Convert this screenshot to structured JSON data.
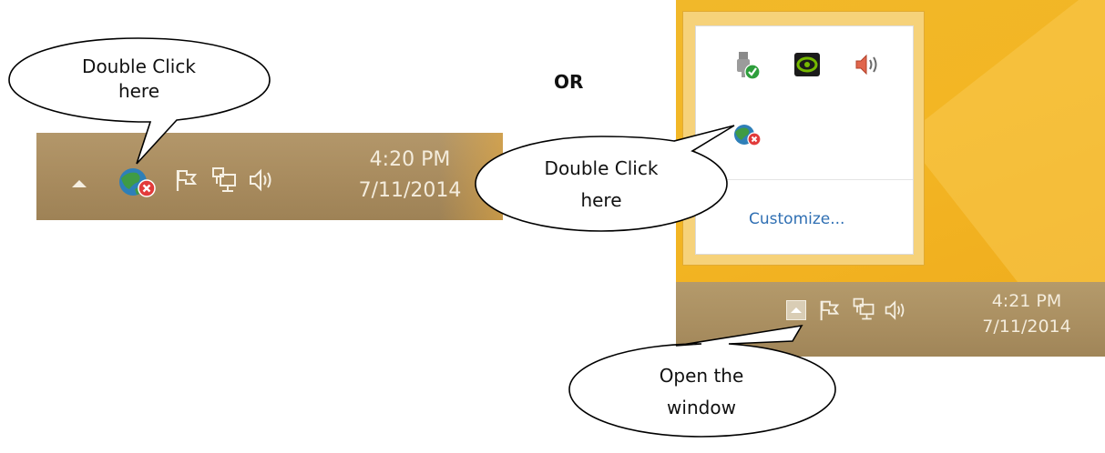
{
  "separator": {
    "label": "OR"
  },
  "callouts": {
    "left_top": {
      "line1": "Double Click",
      "line2": "here"
    },
    "right_middle": {
      "line1": "Double Click",
      "line2": "here"
    },
    "right_bottom": {
      "line1": "Open the",
      "line2": "window"
    }
  },
  "left_taskbar": {
    "clock": {
      "time": "4:20 PM",
      "date": "7/11/2014"
    },
    "icons": [
      "show-hidden-icons-arrow-icon",
      "network-app-error-icon",
      "action-center-flag-icon",
      "network-wired-icon",
      "speaker-volume-icon"
    ]
  },
  "right_screenshot": {
    "tray_popup": {
      "icons": [
        "usb-safely-remove-icon",
        "nvidia-icon",
        "speaker-volume-icon",
        "network-app-error-icon"
      ],
      "customize_label": "Customize..."
    },
    "taskbar": {
      "clock": {
        "time": "4:21 PM",
        "date": "7/11/2014"
      },
      "icons": [
        "show-hidden-icons-arrow-icon",
        "action-center-flag-icon",
        "network-wired-icon",
        "speaker-volume-icon"
      ]
    }
  },
  "colors": {
    "taskbar": "#a88b5e",
    "desktop": "#f1b82a",
    "link": "#2f6fb3",
    "error_badge": "#e23b3b"
  }
}
